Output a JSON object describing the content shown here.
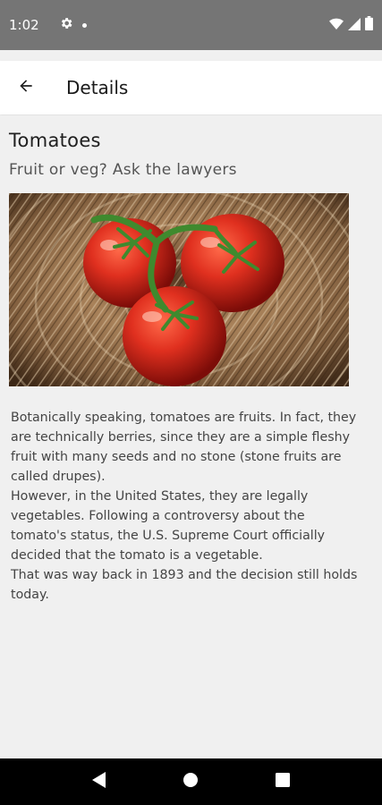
{
  "status_bar": {
    "time": "1:02",
    "icons": [
      "gear-icon",
      "dot-icon",
      "wifi-icon",
      "signal-icon",
      "battery-icon"
    ]
  },
  "app_bar": {
    "back_icon": "arrow-left-icon",
    "title": "Details"
  },
  "article": {
    "title": "Tomatoes",
    "subtitle": "Fruit or veg? Ask the lawyers",
    "image_alt": "tomatoes-photo",
    "body": "Botanically speaking, tomatoes are  fruits. In fact, they are technically berries, since they are a simple fleshy fruit with many seeds and no stone (stone fruits are called drupes).\nHowever, in the United States, they are legally vegetables. Following a controversy about the tomato's status, the U.S. Supreme Court officially decided that the tomato is a vegetable.\nThat was way back in 1893 and the decision still holds today."
  },
  "nav_bar": {
    "buttons": [
      "back-triangle-icon",
      "home-circle-icon",
      "recents-square-icon"
    ]
  },
  "colors": {
    "status_bar": "#757575",
    "app_bar": "#ffffff",
    "background": "#f0f0f0",
    "nav_bar": "#000000",
    "tomato_red": "#d42a1f",
    "stem_green": "#3f8a2e"
  }
}
